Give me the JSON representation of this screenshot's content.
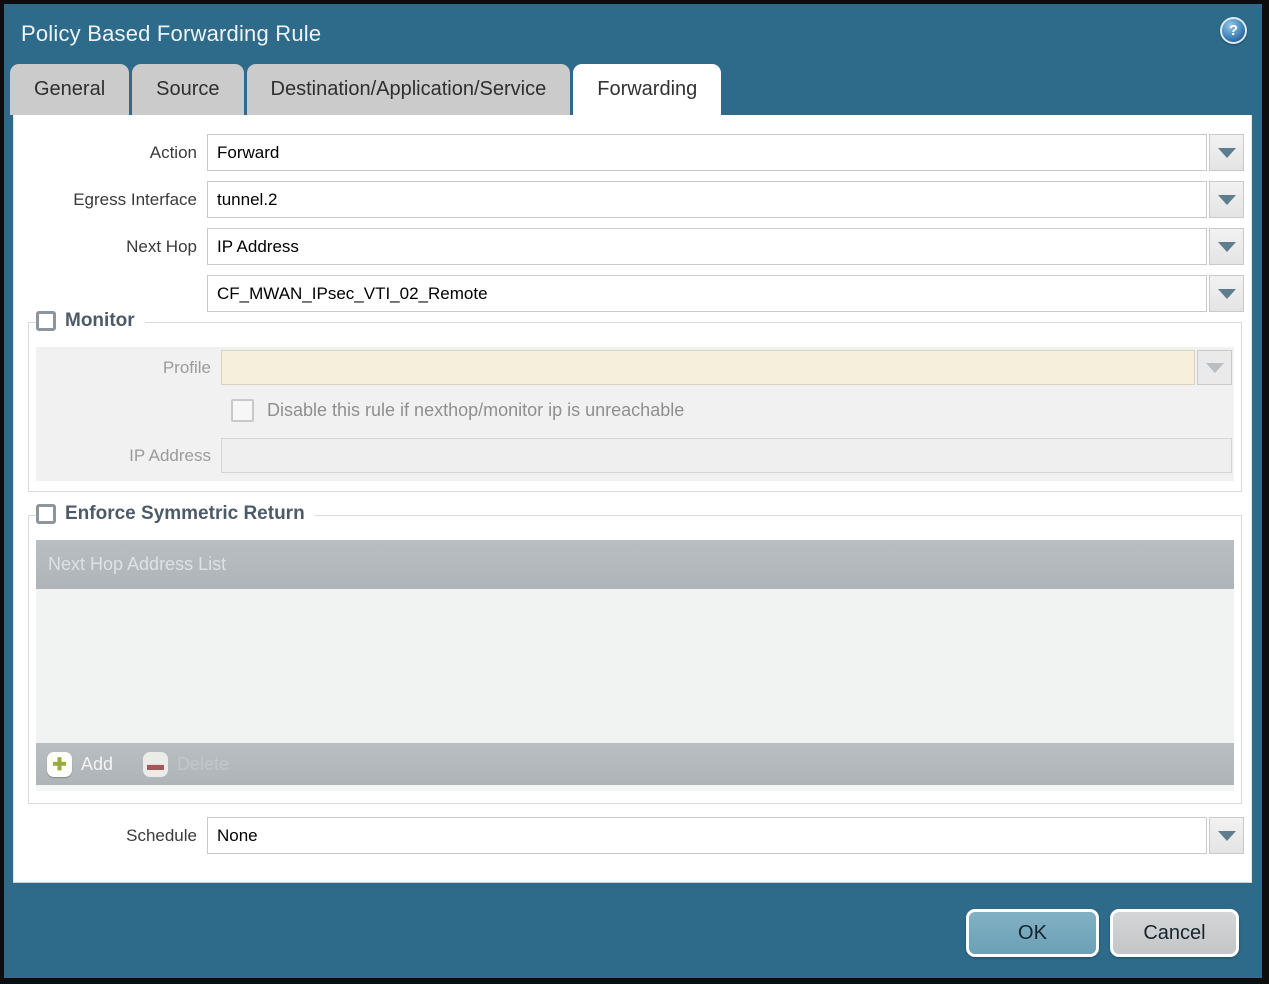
{
  "colors": {
    "titlebar_teal": "#2e6b8a",
    "tab_inactive_gray": "#cbcbcb",
    "tab_active_white": "#ffffff",
    "disabled_field_beige": "#f5efdc",
    "table_header_gray": "#b2b8bc",
    "ok_button_blue": "#74a7bb",
    "cancel_button_gray": "#c9cbcd",
    "add_icon_green": "#98ab3f",
    "delete_icon_red": "#a3585a"
  },
  "dialog": {
    "title": "Policy Based Forwarding Rule",
    "help_glyph": "?"
  },
  "tabs": [
    {
      "label": "General"
    },
    {
      "label": "Source"
    },
    {
      "label": "Destination/Application/Service"
    },
    {
      "label": "Forwarding"
    }
  ],
  "form": {
    "action": {
      "label": "Action",
      "value": "Forward"
    },
    "egress_interface": {
      "label": "Egress Interface",
      "value": "tunnel.2"
    },
    "next_hop": {
      "label": "Next Hop",
      "value": "IP Address"
    },
    "next_hop_address": {
      "value": "CF_MWAN_IPsec_VTI_02_Remote"
    },
    "monitor": {
      "legend": "Monitor",
      "profile": {
        "label": "Profile",
        "value": ""
      },
      "disable_rule_label": "Disable this rule if nexthop/monitor ip is unreachable",
      "ip_address": {
        "label": "IP Address",
        "value": ""
      }
    },
    "enforce": {
      "legend": "Enforce Symmetric Return",
      "table_header": "Next Hop Address List",
      "add_label": "Add",
      "delete_label": "Delete",
      "add_glyph": "✚",
      "delete_glyph": "▬"
    },
    "schedule": {
      "label": "Schedule",
      "value": "None"
    }
  },
  "footer": {
    "ok": "OK",
    "cancel": "Cancel"
  }
}
